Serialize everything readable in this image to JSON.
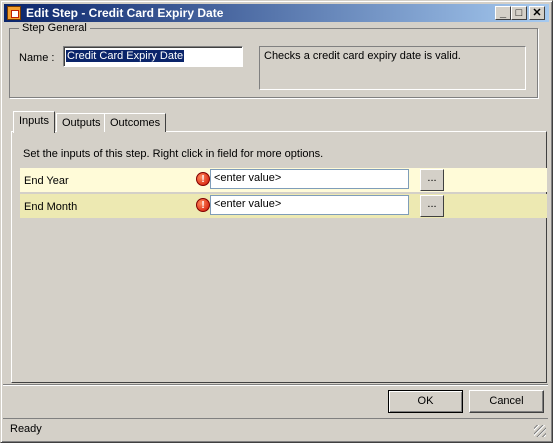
{
  "window": {
    "title": "Edit Step - Credit Card Expiry Date"
  },
  "controls": {
    "minimize": "_",
    "maximize": "□",
    "close": "✕"
  },
  "group": {
    "label": "Step General",
    "name_label": "Name :",
    "name_value": "Credit Card Expiry Date",
    "description": "Checks a credit card expiry date is valid."
  },
  "tabs": [
    {
      "label": "Inputs",
      "active": true
    },
    {
      "label": "Outputs",
      "active": false
    },
    {
      "label": "Outcomes",
      "active": false
    }
  ],
  "inputs": {
    "instructions": "Set the inputs of this step.  Right click in field for more options.",
    "rows": [
      {
        "label": "End Year",
        "value": "<enter value>",
        "button": "..."
      },
      {
        "label": "End Month",
        "value": "<enter value>",
        "button": "..."
      }
    ],
    "warning_glyph": "!"
  },
  "buttons": {
    "ok": "OK",
    "cancel": "Cancel"
  },
  "status": {
    "text": "Ready"
  },
  "colors": {
    "titlebar_start": "#0a246a",
    "titlebar_end": "#a6caf0",
    "row_even": "#fffbd8",
    "row_odd": "#ede9b2"
  }
}
